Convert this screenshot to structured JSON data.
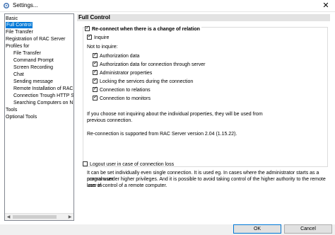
{
  "window": {
    "title": "Settings...",
    "close_glyph": "✕"
  },
  "tree": {
    "items": [
      {
        "label": "Basic"
      },
      {
        "label": "Full Control"
      },
      {
        "label": "File Transfer"
      },
      {
        "label": "Registration of RAC Server"
      },
      {
        "label": "Profiles for"
      },
      {
        "label": "File Transfer"
      },
      {
        "label": "Command Prompt"
      },
      {
        "label": "Screen Recording"
      },
      {
        "label": "Chat"
      },
      {
        "label": "Sending message"
      },
      {
        "label": "Remote Installation of RAC"
      },
      {
        "label": "Connection Trough HTTP S"
      },
      {
        "label": "Searching Computers on N"
      },
      {
        "label": "Tools"
      },
      {
        "label": "Optional Tools"
      }
    ],
    "selected_index": 1,
    "scroll_left_glyph": "◀",
    "scroll_right_glyph": "▶"
  },
  "section": {
    "title": "Full Control"
  },
  "options": {
    "reconnect_label": "Re-connect when there is a change of relation",
    "reconnect_checked": true,
    "inquire_label": "Inquire",
    "inquire_checked": true,
    "not_inquire_label": "Not to inquire:",
    "sub_items": [
      {
        "label": "Authorization data",
        "checked": true
      },
      {
        "label": "Authorization data for connection through server",
        "checked": true
      },
      {
        "label": "Administrator properties",
        "checked": true
      },
      {
        "label": "Locking the services during the connection",
        "checked": true
      },
      {
        "label": "Connection to relations",
        "checked": true
      },
      {
        "label": "Connection to monitors",
        "checked": true
      }
    ],
    "note_line1": "If you choose not inquiring about the individual properties, they will be used from",
    "note_line2": "previous connection.",
    "support_note": "Re-connection is supported from RAC Server version 2.04 (1.15.22).",
    "logout_label": "Logout user in case of connection loss",
    "logout_checked": false,
    "logout_desc1": "It can be set individually even single connection. It is used eg. In cases where the administrator starts as a normal user",
    "logout_desc2": "program under higher privileges. And it is possible to avoid taking control of the higher authority to the remote user in",
    "logout_desc3": "loss of control of a remote computer."
  },
  "buttons": {
    "ok": "OK",
    "cancel": "Cancel"
  },
  "colors": {
    "selection": "#0078d7",
    "header_bg": "#e3e3e3",
    "footer_bg": "#f0f0f0"
  }
}
